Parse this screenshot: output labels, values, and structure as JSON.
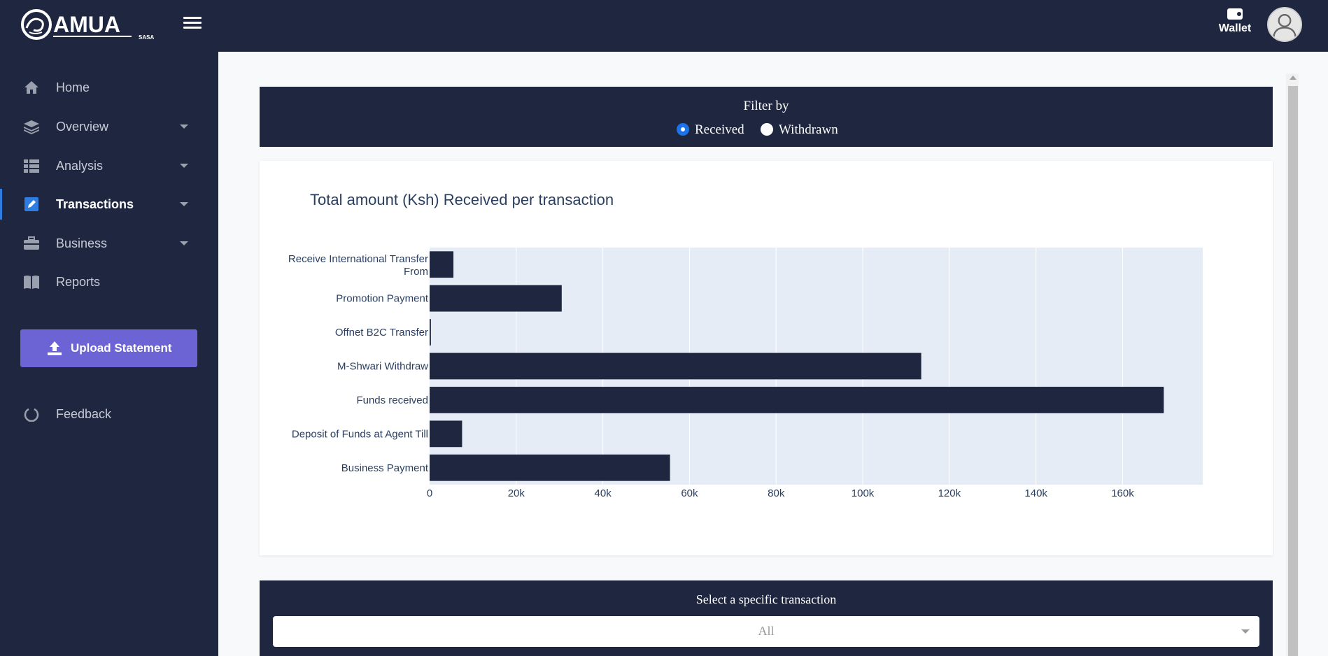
{
  "app": {
    "logo_text": "AMUA",
    "logo_subtext": "SASA",
    "logo_icon": "wave-circle-icon",
    "menu_icon": "hamburger-icon"
  },
  "header": {
    "wallet_label": "Wallet",
    "wallet_icon": "wallet-icon",
    "avatar_icon": "user-avatar-icon"
  },
  "sidebar": {
    "items": [
      {
        "label": "Home",
        "icon": "home-icon",
        "has_caret": false
      },
      {
        "label": "Overview",
        "icon": "layers-icon",
        "has_caret": true
      },
      {
        "label": "Analysis",
        "icon": "table-list-icon",
        "has_caret": true
      },
      {
        "label": "Transactions",
        "icon": "edit-square-icon",
        "has_caret": true,
        "active": true
      },
      {
        "label": "Business",
        "icon": "briefcase-icon",
        "has_caret": true
      },
      {
        "label": "Reports",
        "icon": "book-icon",
        "has_caret": false
      }
    ],
    "upload_label": "Upload Statement",
    "upload_icon": "upload-icon",
    "feedback_label": "Feedback",
    "feedback_icon": "circle-notch-icon"
  },
  "filter": {
    "title": "Filter by",
    "options": [
      {
        "label": "Received",
        "checked": true
      },
      {
        "label": "Withdrawn",
        "checked": false
      }
    ]
  },
  "chart_data": {
    "type": "bar",
    "orientation": "horizontal",
    "title": "Total amount (Ksh) Received per transaction",
    "categories": [
      "Receive International Transfer From",
      "Promotion Payment",
      "Offnet B2C Transfer",
      "M-Shwari Withdraw",
      "Funds received",
      "Deposit of Funds at Agent Till",
      "Business Payment"
    ],
    "values": [
      5500,
      30500,
      300,
      113500,
      169500,
      7500,
      55500
    ],
    "xlim": [
      0,
      178500
    ],
    "xticks": [
      0,
      20000,
      40000,
      60000,
      80000,
      100000,
      120000,
      140000,
      160000
    ],
    "xtick_labels": [
      "0",
      "20k",
      "40k",
      "60k",
      "80k",
      "100k",
      "120k",
      "140k",
      "160k"
    ],
    "xlabel": "",
    "ylabel": "",
    "grid": true,
    "bar_color": "#1f2640",
    "plot_bg": "#e5ecf6"
  },
  "select": {
    "title": "Select a specific transaction",
    "value": "All"
  },
  "colors": {
    "nav_bg": "#1f2640",
    "accent": "#6c63d4",
    "active_indicator": "#2f7de1",
    "radio_checked": "#1a73e8"
  }
}
